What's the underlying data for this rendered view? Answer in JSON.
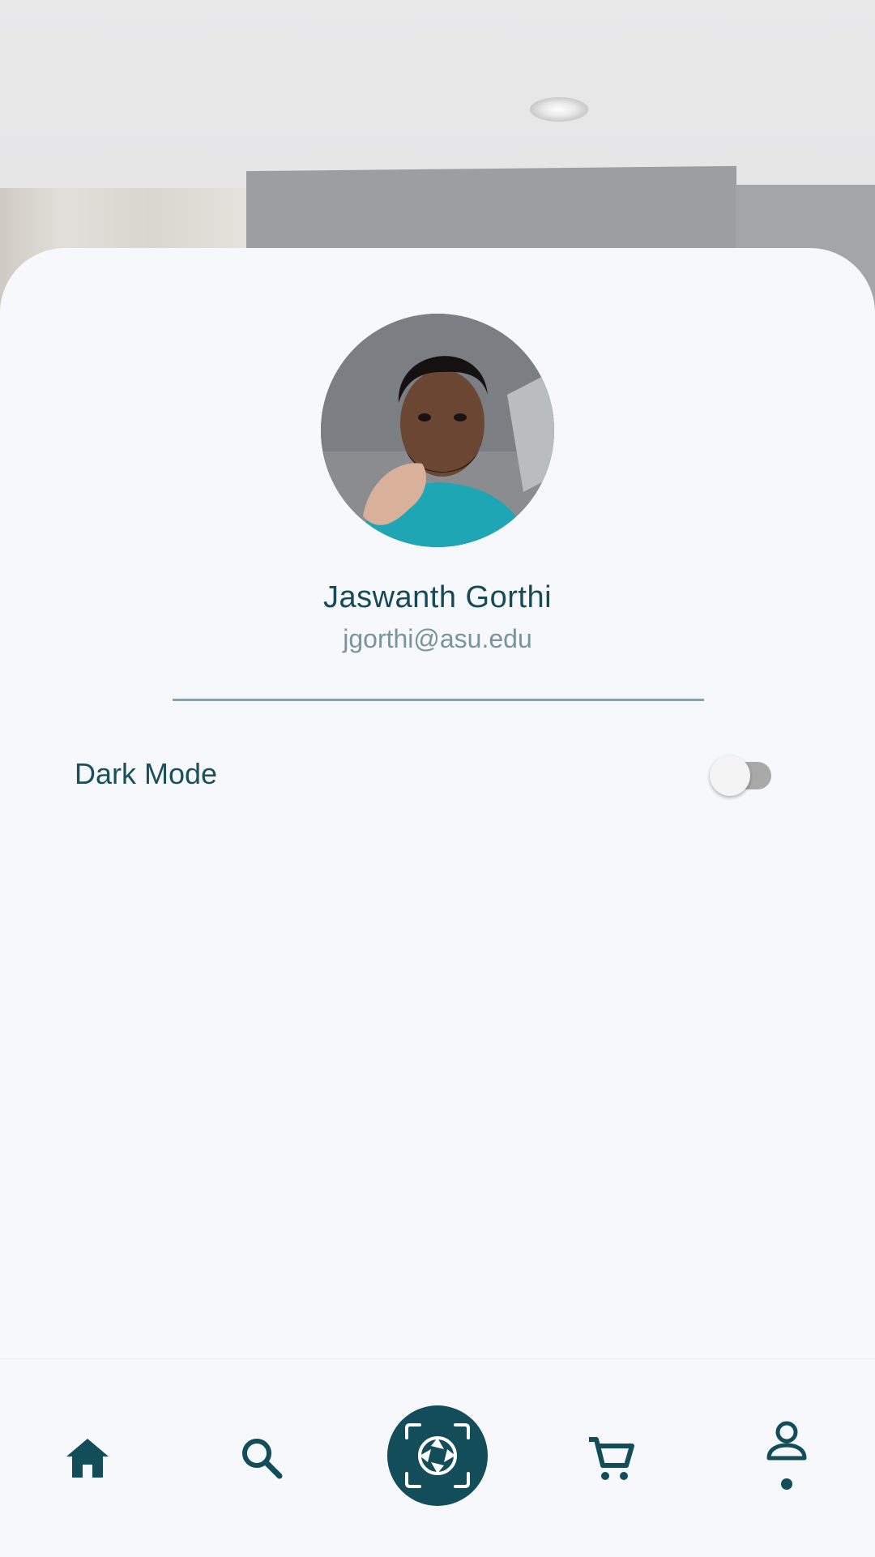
{
  "profile": {
    "name": "Jaswanth Gorthi",
    "email": "jgorthi@asu.edu",
    "avatar_icon": "profile-photo"
  },
  "settings": {
    "dark_mode_label": "Dark Mode",
    "dark_mode_enabled": false
  },
  "nav": {
    "items": [
      {
        "icon": "home-icon"
      },
      {
        "icon": "search-icon"
      },
      {
        "icon": "camera-scan-icon"
      },
      {
        "icon": "cart-icon"
      },
      {
        "icon": "profile-icon",
        "active": true
      }
    ]
  },
  "colors": {
    "accent": "#134d59",
    "card_bg": "#f6f8fc",
    "divider": "#86a3ab",
    "toggle_off_track": "#a9a9a9"
  }
}
